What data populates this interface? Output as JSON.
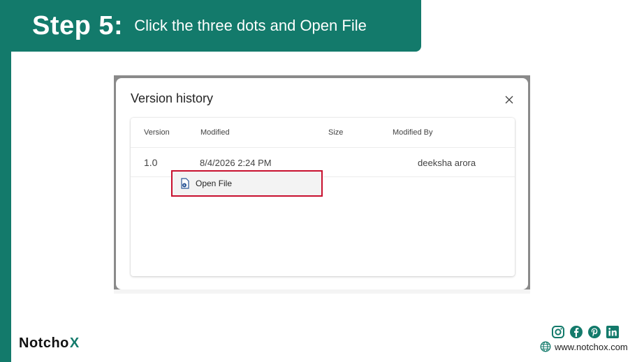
{
  "banner": {
    "step": "Step 5:",
    "description": "Click the three dots and Open File",
    "color": "#137a6b"
  },
  "dialog": {
    "title": "Version history",
    "columns": [
      "Version",
      "Modified",
      "Size",
      "Modified By"
    ],
    "rows": [
      {
        "version": "1.0",
        "modified": "8/4/2026 2:24 PM",
        "size": "",
        "modified_by": "deeksha arora"
      }
    ],
    "context_menu": {
      "open_file_label": "Open File",
      "highlight_color": "#c8102e"
    }
  },
  "footer": {
    "brand": "NotchoX",
    "brand_main": "Notcho",
    "brand_mark": "X",
    "website": "www.notchox.com",
    "social_icons": [
      "instagram-icon",
      "facebook-icon",
      "pinterest-icon",
      "linkedin-icon"
    ]
  }
}
